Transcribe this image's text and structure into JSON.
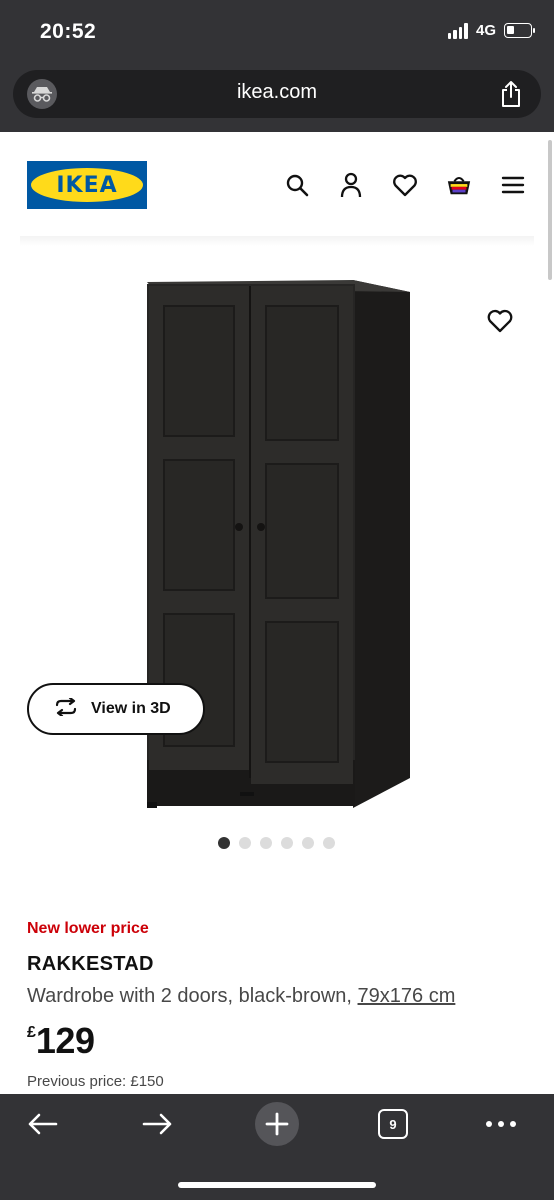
{
  "status_bar": {
    "time": "20:52",
    "network": "4G"
  },
  "browser": {
    "url": "ikea.com",
    "tab_count": "9"
  },
  "header": {
    "logo_text": "IKEA"
  },
  "gallery": {
    "view_3d_label": "View in 3D",
    "image_count": 6,
    "active_index": 0
  },
  "product": {
    "badge": "New lower price",
    "name": "RAKKESTAD",
    "description": "Wardrobe with 2 doors, black-brown,",
    "size": "79x176 cm",
    "currency": "£",
    "price": "129",
    "previous_price": "Previous price: £150"
  },
  "colors": {
    "ikea_blue": "#0058a3",
    "ikea_yellow": "#ffda1a",
    "price_red": "#cc0008",
    "chrome_dark": "#333336"
  },
  "icons": [
    "incognito-icon",
    "share-icon",
    "search-icon",
    "account-icon",
    "favourite-icon",
    "basket-icon",
    "menu-icon",
    "heart-icon",
    "rotate-3d-icon",
    "back-icon",
    "forward-icon",
    "plus-icon",
    "tabs-icon",
    "more-icon"
  ]
}
